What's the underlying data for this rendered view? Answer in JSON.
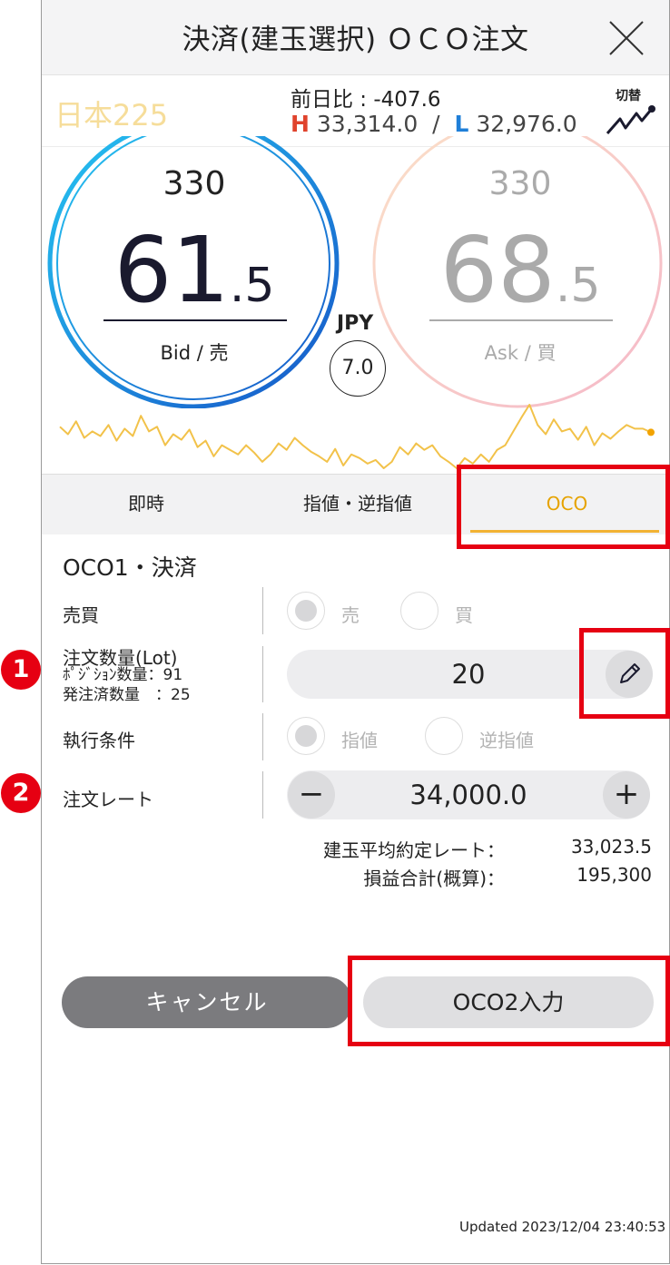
{
  "header": {
    "title": "決済(建玉選択) ＯＣＯ注文",
    "close_icon": "close-icon"
  },
  "info": {
    "instrument": "日本225",
    "prev_change": "前日比 : -407.6",
    "high_mark": "H",
    "high_value": "33,314.0",
    "separator": "/",
    "low_mark": "L",
    "low_value": "32,976.0",
    "switch_label": "切替",
    "switch_icon": "chart-switch-icon"
  },
  "bid": {
    "qty": "330",
    "int": "61",
    "dec": ".5",
    "label": "Bid / 売",
    "ring_color": "#1e7fd8"
  },
  "ask": {
    "qty": "330",
    "int": "68",
    "dec": ".5",
    "label": "Ask / 買",
    "ring_color": "#f7c9c9"
  },
  "spread": {
    "currency": "JPY",
    "value": "7.0"
  },
  "tabs": [
    {
      "label": "即時"
    },
    {
      "label": "指値・逆指値"
    },
    {
      "label": "OCO",
      "active": true
    }
  ],
  "form": {
    "section_title": "OCO1・決済",
    "side": {
      "label": "売買",
      "options": [
        "売",
        "買"
      ],
      "selected": "売"
    },
    "quantity": {
      "label": "注文数量(Lot)",
      "position_label": "ﾎﾟｼﾞｼｮﾝ数量：91",
      "ordered_label": "発注済数量　：25",
      "value": "20",
      "edit_icon": "pencil-icon"
    },
    "condition": {
      "label": "執行条件",
      "options": [
        "指値",
        "逆指値"
      ],
      "selected": "指値"
    },
    "rate": {
      "label": "注文レート",
      "value": "34,000.0",
      "minus": "−",
      "plus": "+"
    },
    "avg_rate_label": "建玉平均約定レート：",
    "avg_rate_value": "33,023.5",
    "pnl_label": "損益合計(概算)：",
    "pnl_value": "195,300"
  },
  "buttons": {
    "cancel": "キャンセル",
    "oco2": "OCO2入力"
  },
  "updated": "Updated  2023/12/04 23:40:53",
  "callouts": {
    "badge1": "1",
    "badge2": "2",
    "highlight_color": "#e60012"
  },
  "chart_data": {
    "type": "line",
    "values": [
      60,
      52,
      66,
      48,
      55,
      50,
      62,
      45,
      58,
      50,
      72,
      55,
      60,
      40,
      52,
      46,
      57,
      38,
      45,
      28,
      40,
      35,
      30,
      40,
      32,
      22,
      30,
      42,
      35,
      48,
      40,
      33,
      28,
      22,
      36,
      18,
      30,
      26,
      20,
      24,
      15,
      22,
      38,
      30,
      42,
      35,
      40,
      28,
      22,
      15,
      26,
      20,
      30,
      22,
      35,
      40,
      55,
      70,
      84,
      62,
      52,
      68,
      55,
      58,
      46,
      60,
      40,
      53,
      47,
      55,
      62,
      58,
      58,
      54
    ],
    "color": "#f2c24a"
  }
}
